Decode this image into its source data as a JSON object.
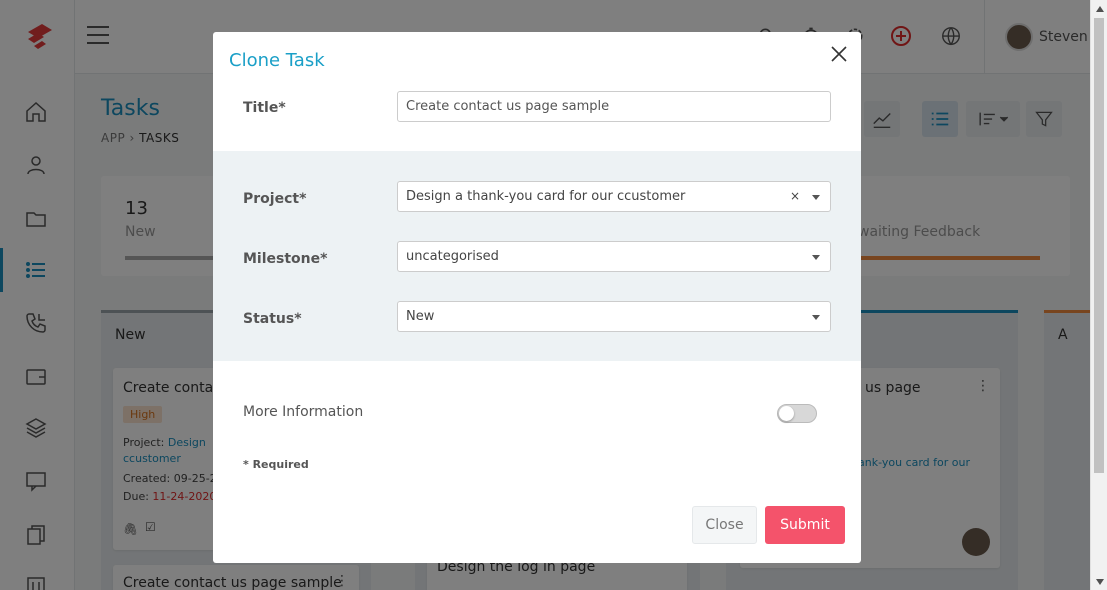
{
  "app": {
    "title": "Tasks",
    "breadcrumb": [
      "APP",
      "TASKS"
    ],
    "user_name": "Steven",
    "stats": [
      {
        "number": "13",
        "label": "New"
      },
      {
        "number": "",
        "label": "waiting Feedback"
      }
    ],
    "columns": [
      {
        "title": "New"
      },
      {
        "title": "A"
      }
    ],
    "cards": {
      "card1_title": "Create conta",
      "card1_priority": "High",
      "card1_project_label": "Project:",
      "card1_project_value": "Design",
      "card1_project_cont": "ccustomer",
      "card1_created": "Created: 09-25-2",
      "card1_due_label": "Due:",
      "card1_due_value": "11-24-2020",
      "card2_title": "Create contact us page sample",
      "card3_title": "Design the log in page",
      "card4_title": "t us page",
      "card4_sub": "ank-you card for our"
    }
  },
  "modal": {
    "title": "Clone Task",
    "fields": {
      "title_label": "Title*",
      "title_value": "Create contact us page sample",
      "project_label": "Project*",
      "project_value": "Design a thank-you card for our ccustomer",
      "project_clear": "×",
      "milestone_label": "Milestone*",
      "milestone_value": "uncategorised",
      "status_label": "Status*",
      "status_value": "New"
    },
    "more_info_label": "More Information",
    "more_info_enabled": false,
    "required_note": "* Required",
    "close_label": "Close",
    "submit_label": "Submit",
    "colors": {
      "title": "#1a9fc7",
      "submit": "#f4536b"
    }
  }
}
